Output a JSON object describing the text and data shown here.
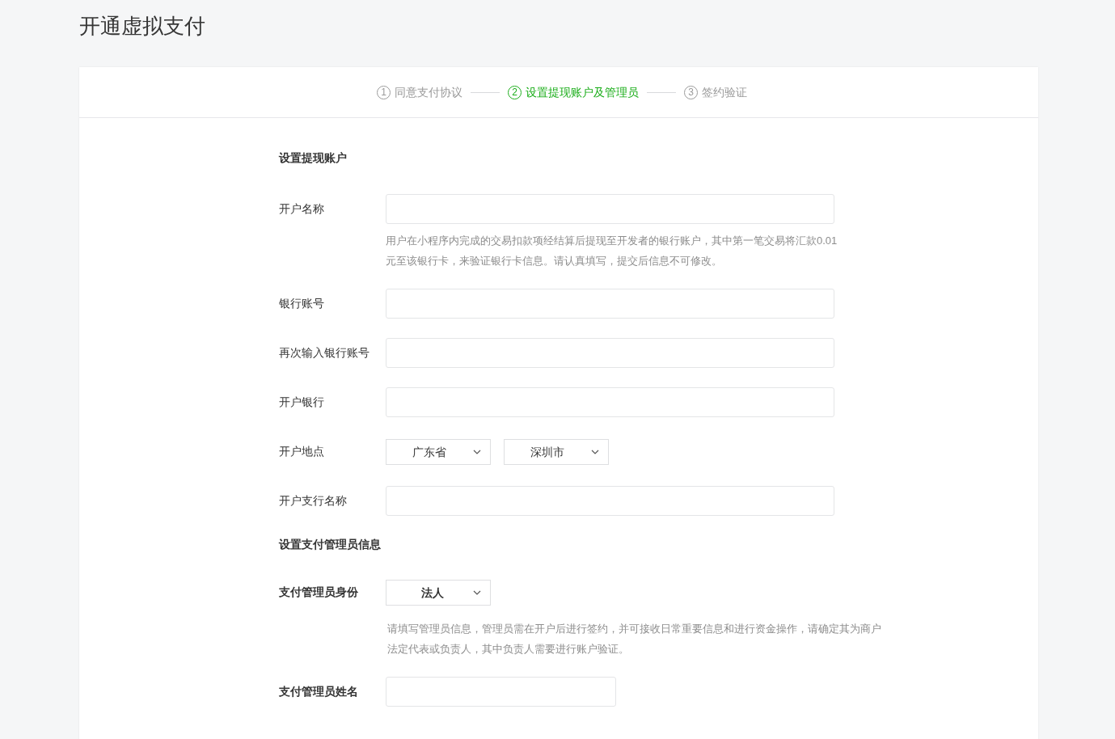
{
  "title": "开通虚拟支付",
  "steps": [
    {
      "number": "1",
      "label": "同意支付协议",
      "selected": false
    },
    {
      "number": "2",
      "label": "设置提现账户及管理员",
      "selected": true
    },
    {
      "number": "3",
      "label": "签约验证",
      "selected": false
    }
  ],
  "sections": [
    {
      "heading": "设置提现账户",
      "fields": [
        {
          "kind": "input",
          "label": "开户名称",
          "hint": "用户在小程序内完成的交易扣款项经结算后提现至开发者的银行账户，其中第一笔交易将汇款0.01元至该银行卡，来验证银行卡信息。请认真填写，提交后信息不可修改。"
        },
        {
          "kind": "input",
          "label": "银行账号"
        },
        {
          "kind": "input",
          "label": "再次输入银行账号"
        },
        {
          "kind": "input",
          "label": "开户银行"
        },
        {
          "kind": "selects",
          "label": "开户地点",
          "values": [
            "广东省",
            "深圳市"
          ]
        },
        {
          "kind": "input",
          "label": "开户支行名称"
        }
      ]
    },
    {
      "heading": "设置支付管理员信息",
      "fields": [
        {
          "kind": "selects",
          "label": "支付管理员身份",
          "values": [
            "法人"
          ],
          "hint": "请填写管理员信息，管理员需在开户后进行签约，并可接收日常重要信息和进行资金操作，请确定其为商户法定代表或负责人，其中负责人需要进行账户验证。"
        },
        {
          "kind": "short-input",
          "label": "支付管理员姓名"
        }
      ]
    }
  ]
}
